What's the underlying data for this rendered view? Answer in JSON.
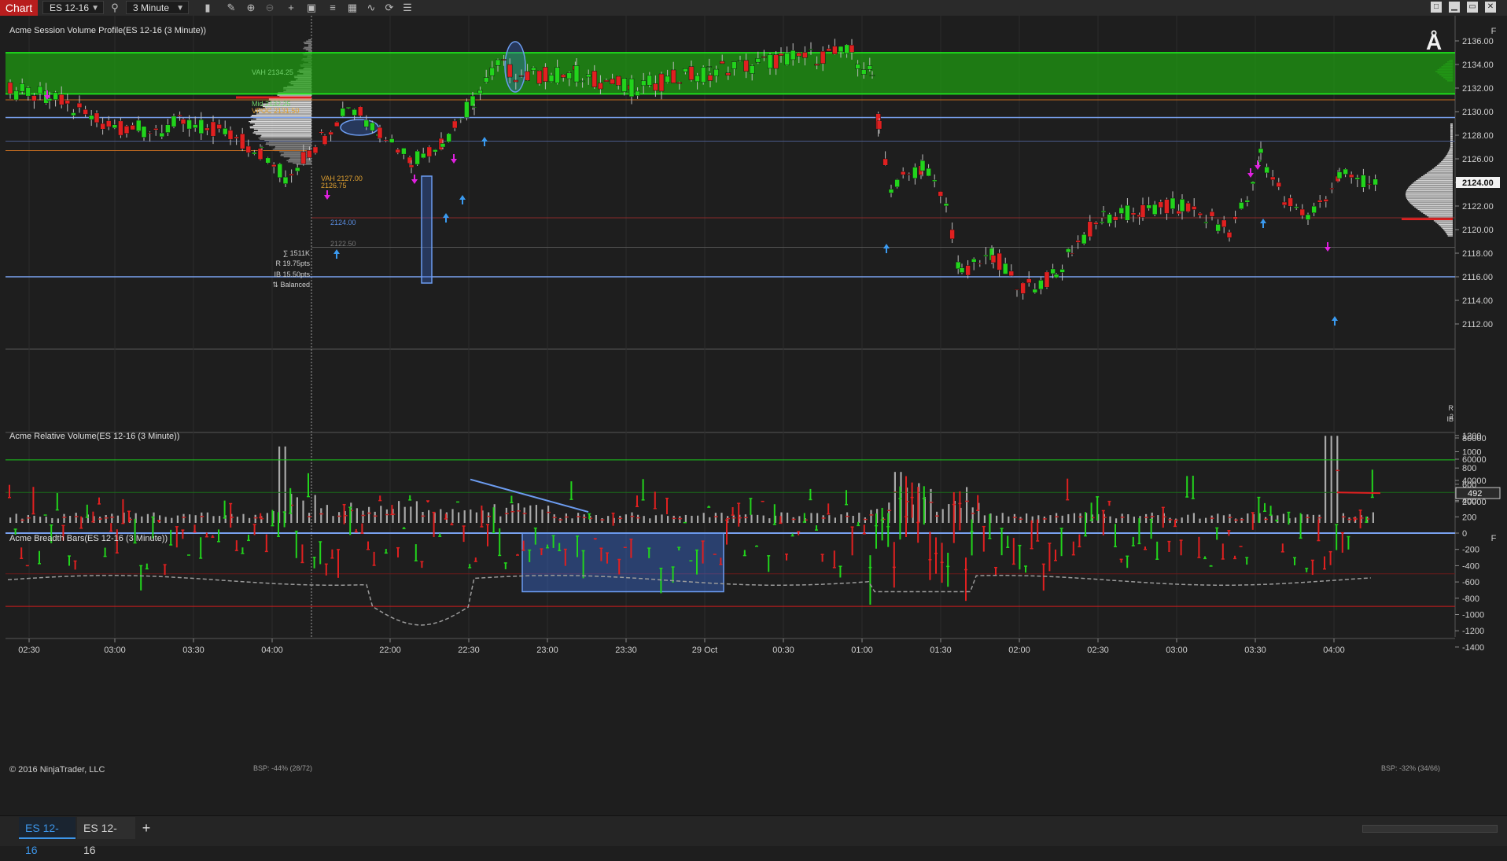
{
  "toolbar": {
    "chart_tab": "Chart",
    "instrument": "ES 12-16",
    "interval": "3 Minute",
    "icons": [
      "search-icon",
      "bar-type-icon",
      "pencil-icon",
      "zoom-in-icon",
      "zoom-out-icon",
      "crosshair-icon",
      "data-box-icon",
      "strategy-icon",
      "indicator-icon",
      "drawing-tools-icon",
      "refresh-icon",
      "properties-icon"
    ],
    "window_buttons": [
      "□",
      "▁",
      "▭",
      "✕"
    ]
  },
  "panels": {
    "price_title": "Acme Session Volume Profile(ES 12-16 (3 Minute))",
    "volume_title": "Acme Relative Volume(ES 12-16 (3 Minute))",
    "breadth_title": "Acme Breadth Bars(ES 12-16 (3 Minute))"
  },
  "price_axis": {
    "ticks": [
      "2136.00",
      "2134.00",
      "2132.00",
      "2130.00",
      "2128.00",
      "2126.00",
      "2124.00",
      "2122.00",
      "2120.00",
      "2118.00",
      "2116.00",
      "2114.00",
      "2112.00"
    ],
    "current_price": "2124.00"
  },
  "volume_axis": {
    "ticks": [
      "80000",
      "60000",
      "40000",
      "20000"
    ]
  },
  "breadth_axis": {
    "ticks": [
      "1200",
      "1000",
      "800",
      "600",
      "400",
      "200",
      "0",
      "-200",
      "-400",
      "-600",
      "-800",
      "-1000",
      "-1200",
      "-1400"
    ],
    "current_value": "492"
  },
  "time_axis": {
    "labels": [
      "02:30",
      "03:00",
      "03:30",
      "04:00",
      "22:00",
      "22:30",
      "23:00",
      "23:30",
      "29 Oct",
      "00:30",
      "01:00",
      "01:30",
      "02:00",
      "02:30",
      "03:00",
      "03:30",
      "04:00"
    ]
  },
  "profile_labels": {
    "vah": "VAH 2134.25",
    "mid": "Mid 2132.25",
    "vpoc": "VPOC 2131.50",
    "vah2": "VAH 2127.00",
    "mid2": "2126.75",
    "poc2": "2124.00",
    "val2": "2122.50"
  },
  "session_stats": [
    "∑ 1511K",
    "R 19.75pts",
    "IB 15.50pts",
    "⇅ Balanced"
  ],
  "right_stats": [
    "R 2",
    "IB"
  ],
  "bsp_left": "BSP: -44% (28/72)",
  "bsp_right": "BSP: -32% (34/66)",
  "copyright": "© 2016 NinjaTrader, LLC",
  "f_button": "F",
  "tabs": {
    "active": "ES 12-16",
    "inactive": "ES 12-16",
    "add": "+"
  },
  "colors": {
    "up": "#22d41c",
    "down": "#e02020",
    "value_area": "#1f9a12",
    "blue_line": "#7aa2f0",
    "background": "#1e1e1e"
  }
}
